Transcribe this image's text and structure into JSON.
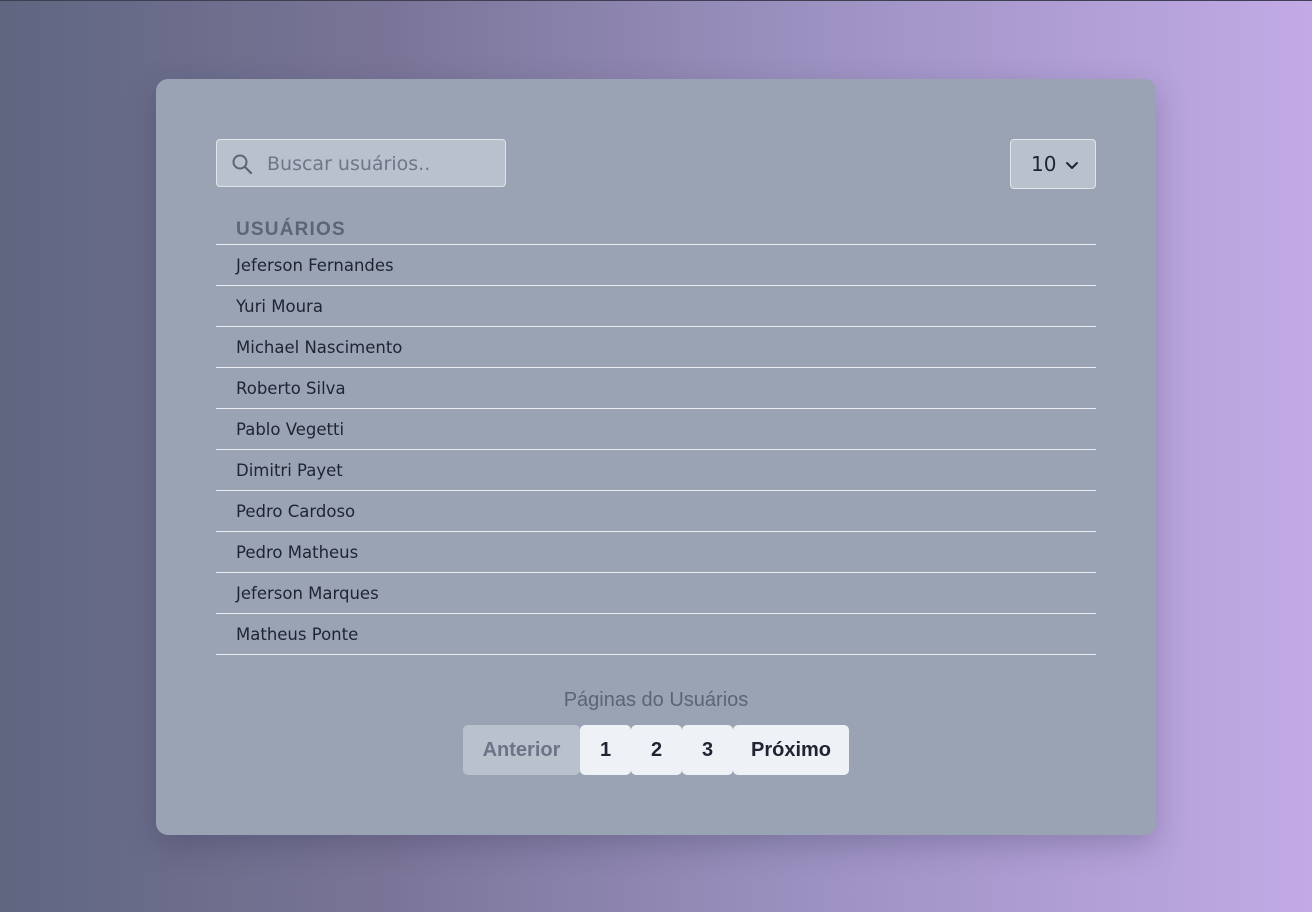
{
  "search": {
    "placeholder": "Buscar usuários.."
  },
  "per_page": {
    "selected": "10"
  },
  "table": {
    "header": "USUÁRIOS",
    "rows": [
      "Jeferson Fernandes",
      "Yuri Moura",
      "Michael Nascimento",
      "Roberto Silva",
      "Pablo Vegetti",
      "Dimitri Payet",
      "Pedro Cardoso",
      "Pedro Matheus",
      "Jeferson Marques",
      "Matheus Ponte"
    ]
  },
  "pagination": {
    "title": "Páginas do Usuários",
    "prev_label": "Anterior",
    "pages": [
      "1",
      "2",
      "3"
    ],
    "next_label": "Próximo"
  },
  "colors": {
    "card": "#99a3b3",
    "input_bg": "#b8c1cc",
    "page_button": "#eef2f6"
  }
}
